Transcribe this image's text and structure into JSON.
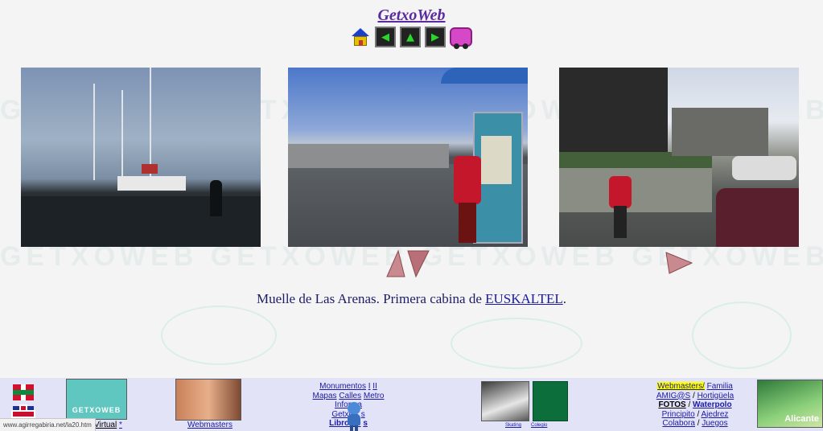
{
  "site": {
    "title": "GetxoWeb"
  },
  "nav": {
    "home_icon": "house-icon",
    "prev_icon": "arrow-left-icon",
    "up_icon": "home-arrow-icon",
    "next_icon": "arrow-right-icon",
    "cart_icon": "cart-icon",
    "prev_glyph": "◀",
    "up_glyph": "▲",
    "next_glyph": "▶"
  },
  "watermark": "GETXOWEB GETXOWEB GETXOWEB GETXOWEB GETXOWEB",
  "photos": [
    {
      "subject": "harbor-boats"
    },
    {
      "subject": "promenade-phone-booth"
    },
    {
      "subject": "street-walkway"
    }
  ],
  "caption": {
    "text": "Muelle de Las Arenas. Primera cabina de ",
    "link": "EUSKALTEL",
    "end": "."
  },
  "footer": {
    "visita": "Visita Virtual",
    "visita_star": "*",
    "getxo_logo": "GETXOWEB",
    "webmasters_left": "Webmasters",
    "center": {
      "monumentos": "Monumentos",
      "sep1": "I",
      "ii": "II",
      "mapas": "Mapas",
      "calles": "Calles",
      "metro": "Metro",
      "informa": "Informa",
      "getxos": "Getxo's",
      "links_tail": "s",
      "libro": "Libro de",
      "libro_tail": "s"
    },
    "skating": "Skating",
    "colegio": "Colegio",
    "right": {
      "webmasters": "Webmasters/",
      "familia": "Familia",
      "amigos": "AMIG@S",
      "slash1": "/",
      "hortiguela": "Hortigüela",
      "fotos": "FOTOS",
      "slash2": "/",
      "waterpolo": "Waterpolo",
      "principito": "Principito",
      "slash3": "/",
      "ajedrez": "Ajedrez",
      "colabora": "Colabora",
      "slash4": "/",
      "juegos": "Juegos"
    },
    "alicante": "Alicante"
  },
  "status_url": "www.agirregabiria.net/la20.htm",
  "colors": {
    "title": "#5b2aa0",
    "caption": "#1d1d66",
    "link": "#1a1aa6",
    "footer_bg": "#e3e3f7",
    "nav_green": "#2bd62b"
  }
}
